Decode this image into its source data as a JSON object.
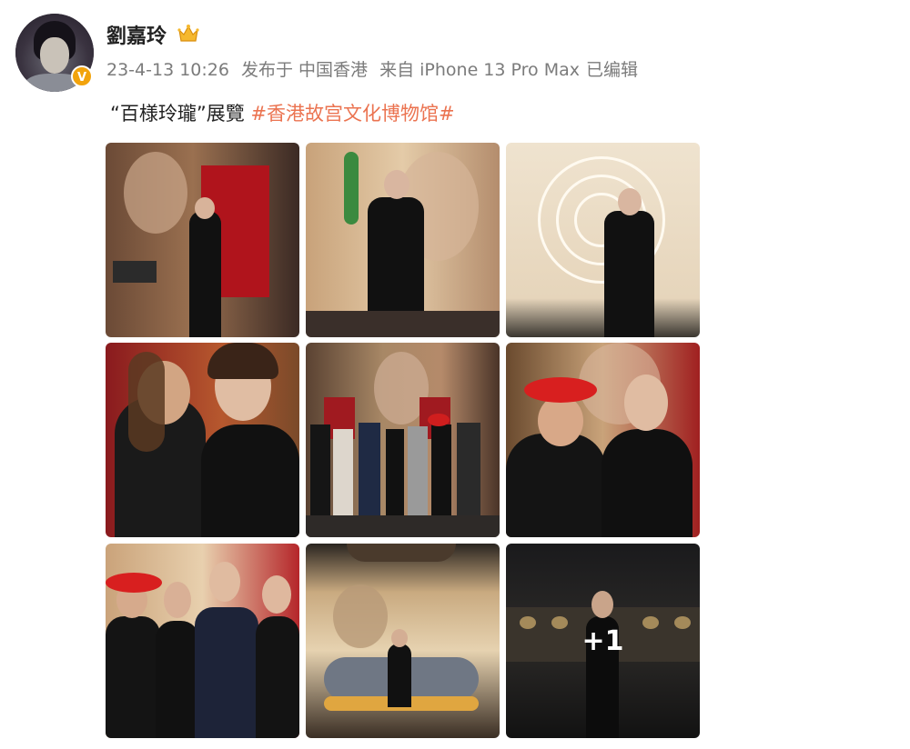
{
  "user": {
    "name": "劉嘉玲",
    "verified_badge": "V"
  },
  "post": {
    "date": "23-4-13 10:26",
    "published_in": "发布于 中国香港",
    "source": "来自 iPhone 13 Pro Max",
    "edited": "已编辑",
    "text": "“百様玲瓏”展覽",
    "hashtag": "#香港故宫文化博物馆#"
  },
  "gallery": {
    "more_count": "+1"
  },
  "colors": {
    "accent": "#eb7350",
    "meta_text": "#7b7b7b",
    "badge": "#f2a30c"
  }
}
